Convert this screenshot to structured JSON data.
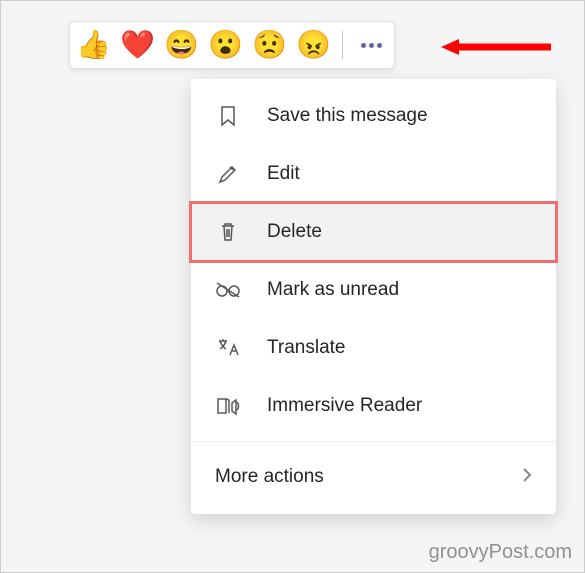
{
  "reactions": {
    "thumbs_up": "👍",
    "heart": "❤️",
    "laugh": "😄",
    "surprised": "😮",
    "sad": "😟",
    "angry": "😠"
  },
  "menu": {
    "save": "Save this message",
    "edit": "Edit",
    "delete": "Delete",
    "mark_unread": "Mark as unread",
    "translate": "Translate",
    "immersive": "Immersive Reader",
    "more": "More actions"
  },
  "watermark": "groovyPost.com"
}
